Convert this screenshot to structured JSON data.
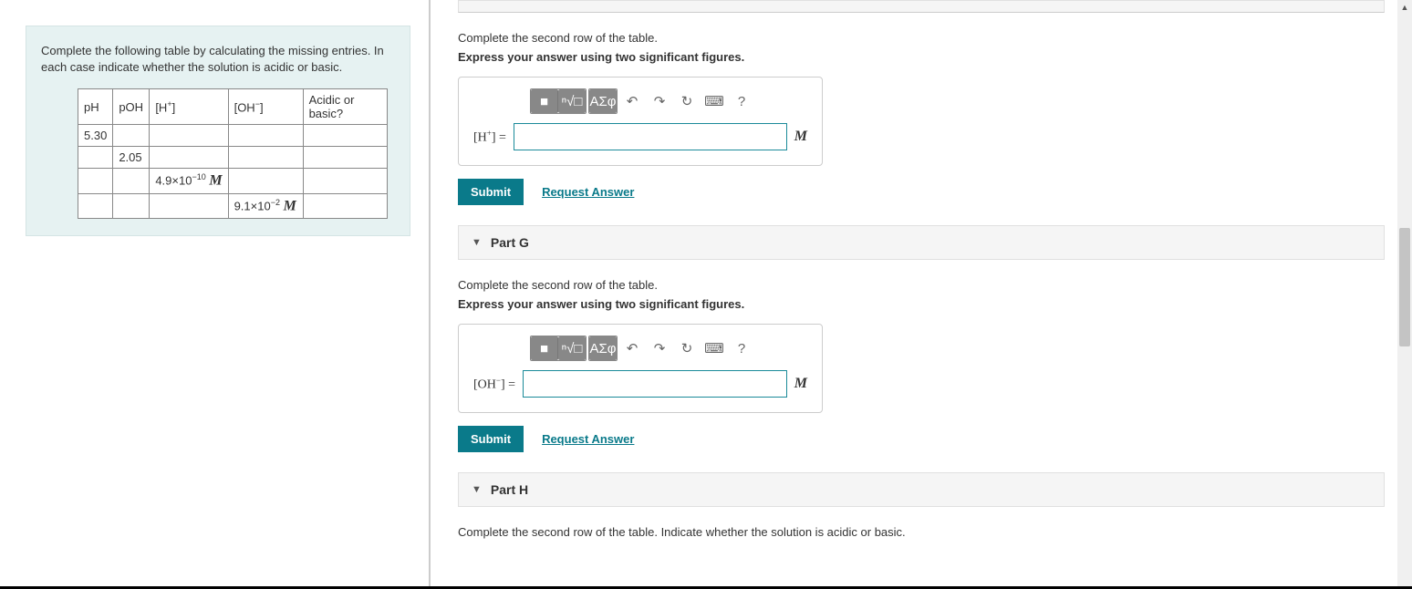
{
  "problem": {
    "instructions": "Complete the following table by calculating the missing entries. In each case indicate whether the solution is acidic or basic.",
    "headers": {
      "ph": "pH",
      "poh": "pOH",
      "h": "[H",
      "h_sup": "+",
      "h_close": "]",
      "oh": "[OH",
      "oh_sup": "−",
      "oh_close": "]",
      "ab": "Acidic or basic?"
    },
    "rows": [
      {
        "ph": "5.30",
        "poh": "",
        "h": "",
        "oh": "",
        "ab": ""
      },
      {
        "ph": "",
        "poh": "2.05",
        "h": "",
        "oh": "",
        "ab": ""
      },
      {
        "ph": "",
        "poh": "",
        "h": "4.9×10",
        "h_exp": "−10",
        "h_unit": "M",
        "oh": "",
        "ab": ""
      },
      {
        "ph": "",
        "poh": "",
        "h": "",
        "oh": "9.1×10",
        "oh_exp": "−2",
        "oh_unit": "M",
        "ab": ""
      }
    ]
  },
  "partF": {
    "instr1": "Complete the second row of the table.",
    "instr2": "Express your answer using two significant figures.",
    "label_open": "[H",
    "label_sup": "+",
    "label_close": "] =",
    "unit": "M",
    "toolbar": {
      "tpl": "■",
      "sqrt": "ⁿ√□",
      "greek": "ΑΣφ",
      "undo": "↶",
      "redo": "↷",
      "reset": "↻",
      "kbd": "⌨",
      "help": "?"
    },
    "submit": "Submit",
    "request": "Request Answer"
  },
  "partG": {
    "title": "Part G",
    "instr1": "Complete the second row of the table.",
    "instr2": "Express your answer using two significant figures.",
    "label_open": "[OH",
    "label_sup": "−",
    "label_close": "] =",
    "unit": "M",
    "toolbar": {
      "tpl": "■",
      "sqrt": "ⁿ√□",
      "greek": "ΑΣφ",
      "undo": "↶",
      "redo": "↷",
      "reset": "↻",
      "kbd": "⌨",
      "help": "?"
    },
    "submit": "Submit",
    "request": "Request Answer"
  },
  "partH": {
    "title": "Part H",
    "instr1": "Complete the second row of the table. Indicate whether the solution is acidic or basic."
  }
}
